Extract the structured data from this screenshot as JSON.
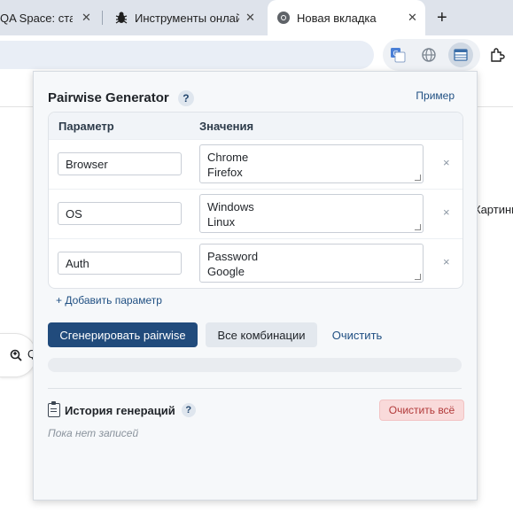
{
  "browser": {
    "tabs": [
      {
        "title": "QA Space: стат",
        "close_icon": "close-icon"
      },
      {
        "title": "Инструменты онлай",
        "close_icon": "close-icon"
      },
      {
        "title": "Новая вкладка",
        "close_icon": "close-icon",
        "active": true
      }
    ],
    "new_tab_symbol": "+",
    "close_symbol": "✕"
  },
  "page": {
    "right_text": "Картинн",
    "left_pill_text": "Q"
  },
  "popup": {
    "title": "Pairwise Generator",
    "help_symbol": "?",
    "example_link": "Пример",
    "table": {
      "header_param": "Параметр",
      "header_values": "Значения",
      "rows": [
        {
          "param": "Browser",
          "values": [
            "Chrome",
            "Firefox"
          ]
        },
        {
          "param": "OS",
          "values": [
            "Windows",
            "Linux"
          ]
        },
        {
          "param": "Auth",
          "values": [
            "Password",
            "Google"
          ]
        }
      ],
      "remove_symbol": "×"
    },
    "add_param_label": "+ Добавить параметр",
    "buttons": {
      "generate": "Сгенерировать pairwise",
      "all_combinations": "Все комбинации",
      "clear": "Очистить"
    },
    "history": {
      "title": "История генераций",
      "help_symbol": "?",
      "clear_all": "Очистить всё",
      "empty": "Пока нет записей"
    }
  },
  "colors": {
    "primary": "#214b7c",
    "link": "#1f4f82",
    "danger_bg": "#f9dada",
    "danger_text": "#b23a3a"
  }
}
